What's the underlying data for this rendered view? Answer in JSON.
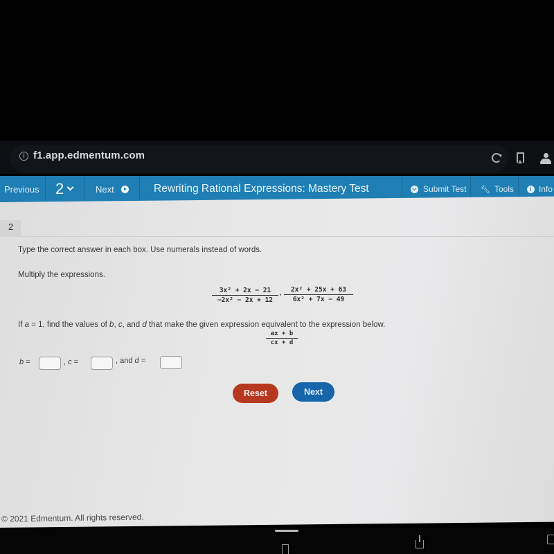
{
  "browser": {
    "url": "f1.app.edmentum.com",
    "icons": [
      "info-icon",
      "reload-icon",
      "bookmark-icon",
      "people-icon"
    ]
  },
  "nav": {
    "previous_label": "Previous",
    "question_number": "2",
    "next_label": "Next",
    "title": "Rewriting Rational Expressions: Mastery Test",
    "submit_label": "Submit Test",
    "tools_label": "Tools",
    "info_label": "Info",
    "accent_color": "#1f7fb4"
  },
  "question": {
    "number": "2",
    "instruction": "Type the correct answer in each box. Use numerals instead of words.",
    "prompt": "Multiply the expressions.",
    "expression": {
      "fraction1": {
        "numerator": "3x² + 2x − 21",
        "denominator": "−2x² − 2x + 12"
      },
      "operator": "·",
      "fraction2": {
        "numerator": "2x² + 25x + 63",
        "denominator": "6x² + 7x − 49"
      }
    },
    "condition_parts": {
      "pre": "If ",
      "a": "a",
      "eq1": " = 1, find the values of ",
      "b": "b",
      "comma1": ", ",
      "c": "c",
      "and": ", and ",
      "d": "d",
      "post": " that make the given expression equivalent to the expression below."
    },
    "target_expression": {
      "numerator": "ax + b",
      "denominator": "cx + d"
    },
    "answers": [
      {
        "var": "b",
        "prefix": "",
        "suffix": " =",
        "value": ""
      },
      {
        "var": "c",
        "prefix": ", ",
        "suffix": " =",
        "value": ""
      },
      {
        "var": "d",
        "prefix": ", and ",
        "suffix": " =",
        "value": ""
      }
    ]
  },
  "buttons": {
    "reset_label": "Reset",
    "reset_color": "#b6391f",
    "next_label": "Next",
    "next_color": "#1566aa"
  },
  "footer": {
    "copyright": "© 2021 Edmentum. All rights reserved."
  }
}
